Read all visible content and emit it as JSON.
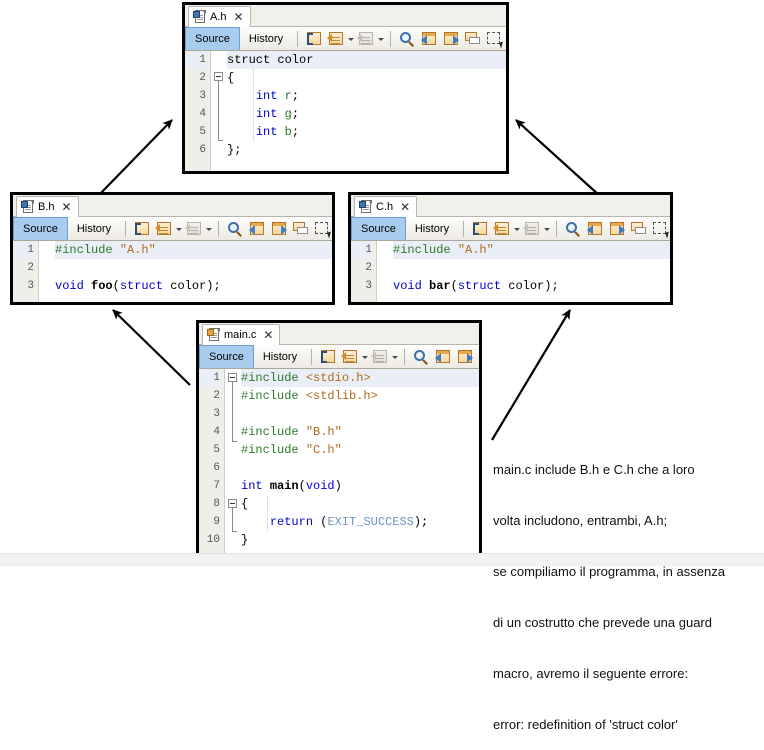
{
  "theme": {
    "window_border": "#000000",
    "toolbar_bg": "#eceae2",
    "active_tab_bg": "#a8cced",
    "gutter_bg": "#efefe9",
    "highlight_line_bg": "#e9eef7",
    "keyword_color": "#0000cc",
    "preproc_color": "#2c7a2c",
    "string_color": "#b06a1a",
    "constant_color": "#6f93c4",
    "page_background": "#ffffff"
  },
  "toolbar": {
    "source_label": "Source",
    "history_label": "History",
    "buttons": [
      {
        "name": "last-edit-icon",
        "title": "Last Edit"
      },
      {
        "name": "back-page-icon",
        "title": "Back"
      },
      {
        "name": "forward-page-icon",
        "title": "Forward"
      },
      {
        "name": "find-selection-icon",
        "title": "Find Selection"
      },
      {
        "name": "previous-bookmark-icon",
        "title": "Previous Bookmark"
      },
      {
        "name": "next-bookmark-icon",
        "title": "Next Bookmark"
      },
      {
        "name": "toggle-bookmark-icon",
        "title": "Toggle Bookmark"
      },
      {
        "name": "rectangular-selection-icon",
        "title": "Rectangular Selection"
      }
    ]
  },
  "windows": {
    "a_h": {
      "tab_label": "A.h",
      "close_label": "✕",
      "lines": [
        {
          "n": "1",
          "highlight": true,
          "tokens": [
            {
              "t": "struct color",
              "c": "id"
            }
          ]
        },
        {
          "n": "2",
          "highlight": false,
          "tokens": [
            {
              "t": "{",
              "c": "p"
            }
          ]
        },
        {
          "n": "3",
          "highlight": false,
          "tokens": [
            {
              "t": "    ",
              "c": "p"
            },
            {
              "t": "int",
              "c": "k"
            },
            {
              "t": " ",
              "c": "p"
            },
            {
              "t": "r",
              "c": "t"
            },
            {
              "t": ";",
              "c": "p"
            }
          ]
        },
        {
          "n": "4",
          "highlight": false,
          "tokens": [
            {
              "t": "    ",
              "c": "p"
            },
            {
              "t": "int",
              "c": "k"
            },
            {
              "t": " ",
              "c": "p"
            },
            {
              "t": "g",
              "c": "t"
            },
            {
              "t": ";",
              "c": "p"
            }
          ]
        },
        {
          "n": "5",
          "highlight": false,
          "tokens": [
            {
              "t": "    ",
              "c": "p"
            },
            {
              "t": "int",
              "c": "k"
            },
            {
              "t": " ",
              "c": "p"
            },
            {
              "t": "b",
              "c": "t"
            },
            {
              "t": ";",
              "c": "p"
            }
          ]
        },
        {
          "n": "6",
          "highlight": false,
          "tokens": [
            {
              "t": "};",
              "c": "p"
            }
          ]
        }
      ]
    },
    "b_h": {
      "tab_label": "B.h",
      "close_label": "✕",
      "lines": [
        {
          "n": "1",
          "highlight": true,
          "tokens": [
            {
              "t": "#include",
              "c": "t"
            },
            {
              "t": " ",
              "c": "p"
            },
            {
              "t": "\"A.h\"",
              "c": "s"
            }
          ]
        },
        {
          "n": "2",
          "highlight": false,
          "tokens": [
            {
              "t": "",
              "c": "p"
            }
          ]
        },
        {
          "n": "3",
          "highlight": false,
          "tokens": [
            {
              "t": "void ",
              "c": "k"
            },
            {
              "t": "foo",
              "c": "fn"
            },
            {
              "t": "(",
              "c": "p"
            },
            {
              "t": "struct",
              "c": "k"
            },
            {
              "t": " color);",
              "c": "p"
            }
          ]
        }
      ]
    },
    "c_h": {
      "tab_label": "C.h",
      "close_label": "✕",
      "lines": [
        {
          "n": "1",
          "highlight": true,
          "tokens": [
            {
              "t": "#include",
              "c": "t"
            },
            {
              "t": " ",
              "c": "p"
            },
            {
              "t": "\"A.h\"",
              "c": "s"
            }
          ]
        },
        {
          "n": "2",
          "highlight": false,
          "tokens": [
            {
              "t": "",
              "c": "p"
            }
          ]
        },
        {
          "n": "3",
          "highlight": false,
          "tokens": [
            {
              "t": "void ",
              "c": "k"
            },
            {
              "t": "bar",
              "c": "fn"
            },
            {
              "t": "(",
              "c": "p"
            },
            {
              "t": "struct",
              "c": "k"
            },
            {
              "t": " color);",
              "c": "p"
            }
          ]
        }
      ]
    },
    "main_c": {
      "tab_label": "main.c",
      "close_label": "✕",
      "lines": [
        {
          "n": "1",
          "highlight": true,
          "tokens": [
            {
              "t": "#include",
              "c": "t"
            },
            {
              "t": " ",
              "c": "p"
            },
            {
              "t": "<stdio.h>",
              "c": "s"
            }
          ]
        },
        {
          "n": "2",
          "highlight": false,
          "tokens": [
            {
              "t": "#include",
              "c": "t"
            },
            {
              "t": " ",
              "c": "p"
            },
            {
              "t": "<stdlib.h>",
              "c": "s"
            }
          ]
        },
        {
          "n": "3",
          "highlight": false,
          "tokens": [
            {
              "t": "",
              "c": "p"
            }
          ]
        },
        {
          "n": "4",
          "highlight": false,
          "tokens": [
            {
              "t": "#include",
              "c": "t"
            },
            {
              "t": " ",
              "c": "p"
            },
            {
              "t": "\"B.h\"",
              "c": "s"
            }
          ]
        },
        {
          "n": "5",
          "highlight": false,
          "tokens": [
            {
              "t": "#include",
              "c": "t"
            },
            {
              "t": " ",
              "c": "p"
            },
            {
              "t": "\"C.h\"",
              "c": "s"
            }
          ]
        },
        {
          "n": "6",
          "highlight": false,
          "tokens": [
            {
              "t": "",
              "c": "p"
            }
          ]
        },
        {
          "n": "7",
          "highlight": false,
          "tokens": [
            {
              "t": "int ",
              "c": "k"
            },
            {
              "t": "main",
              "c": "fn"
            },
            {
              "t": "(",
              "c": "p"
            },
            {
              "t": "void",
              "c": "k"
            },
            {
              "t": ")",
              "c": "p"
            }
          ]
        },
        {
          "n": "8",
          "highlight": false,
          "tokens": [
            {
              "t": "{",
              "c": "p"
            }
          ]
        },
        {
          "n": "9",
          "highlight": false,
          "tokens": [
            {
              "t": "    ",
              "c": "p"
            },
            {
              "t": "return",
              "c": "k"
            },
            {
              "t": " (",
              "c": "p"
            },
            {
              "t": "EXIT_SUCCESS",
              "c": "cn"
            },
            {
              "t": ");",
              "c": "p"
            }
          ]
        },
        {
          "n": "10",
          "highlight": false,
          "tokens": [
            {
              "t": "}",
              "c": "p"
            }
          ]
        }
      ]
    }
  },
  "caption": {
    "line1": "main.c include B.h e C.h che a loro",
    "line2": "volta includono, entrambi, A.h;",
    "line3": "se compiliamo il programma, in assenza",
    "line4": "di un costrutto che prevede una guard",
    "line5": "macro, avremo il seguente errore:",
    "line6": "error: redefinition of 'struct color'"
  },
  "diagram": {
    "arrows": [
      {
        "name": "arrow-b-h-to-a-h",
        "from": "B.h",
        "to": "A.h"
      },
      {
        "name": "arrow-c-h-to-a-h",
        "from": "C.h",
        "to": "A.h"
      },
      {
        "name": "arrow-main-c-to-b-h",
        "from": "main.c",
        "to": "B.h"
      },
      {
        "name": "arrow-main-c-to-c-h",
        "from": "main.c",
        "to": "C.h"
      }
    ]
  }
}
